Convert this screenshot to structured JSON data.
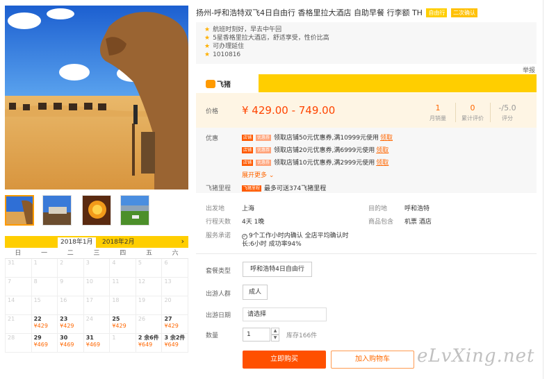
{
  "product": {
    "title": "扬州-呼和浩特双飞4日自由行 香格里拉大酒店 自助早餐 行李额 TH",
    "tags": [
      "自由行",
      "二次确认"
    ],
    "features": [
      "航班时刻好，早去中午回",
      "5星香格里拉大酒店，舒适享受，性价比高",
      "可办理延住",
      "1010816"
    ],
    "report_label": "举报"
  },
  "brand": {
    "name": "飞猪"
  },
  "price": {
    "label": "价格",
    "range": "¥ 429.00 - 749.00",
    "stats": [
      {
        "value": "1",
        "label": "月销量"
      },
      {
        "value": "0",
        "label": "累计评价"
      },
      {
        "value": "-/5.0",
        "label": "评分"
      }
    ]
  },
  "coupons": {
    "label": "优惠",
    "badge1": "店铺",
    "badge2": "优惠券",
    "items": [
      {
        "text": "领取店铺50元优惠券,满10999元使用",
        "action": "领取"
      },
      {
        "text": "领取店铺20元优惠券,满6999元使用",
        "action": "领取"
      },
      {
        "text": "领取店铺10元优惠券,满2999元使用",
        "action": "领取"
      }
    ],
    "more": "展开更多",
    "miles_label": "飞猪里程",
    "miles_badge": "飞猪里程",
    "miles_text": "最多可送374飞猪里程"
  },
  "details": {
    "depart_label": "出发地",
    "depart": "上海",
    "dest_label": "目的地",
    "dest": "呼和浩特",
    "days_label": "行程天数",
    "days": "4天 1晚",
    "includes_label": "商品包含",
    "includes": "机票  酒店",
    "promise_label": "服务承诺",
    "promise_line1": "9个工作小时内确认 全店平均确认时",
    "promise_line2": "长:6小时 成功率94%"
  },
  "options": {
    "package_label": "套餐类型",
    "package_value": "呼和浩特4日自由行",
    "crowd_label": "出游人群",
    "crowd_value": "成人",
    "date_label": "出游日期",
    "date_placeholder": "请选择",
    "qty_label": "数量",
    "qty_value": "1",
    "stock": "库存166件"
  },
  "actions": {
    "buy": "立即购买",
    "cart": "加入购物车"
  },
  "calendar": {
    "months": [
      "2018年1月",
      "2018年2月"
    ],
    "next": "›",
    "weekdays": [
      "日",
      "一",
      "二",
      "三",
      "四",
      "五",
      "六"
    ],
    "rows": [
      [
        {
          "d": "31"
        },
        {
          "d": "1"
        },
        {
          "d": "2"
        },
        {
          "d": "3"
        },
        {
          "d": "4"
        },
        {
          "d": "5"
        },
        {
          "d": "6"
        }
      ],
      [
        {
          "d": "7"
        },
        {
          "d": "8"
        },
        {
          "d": "9"
        },
        {
          "d": "10"
        },
        {
          "d": "11"
        },
        {
          "d": "12"
        },
        {
          "d": "13"
        }
      ],
      [
        {
          "d": "14"
        },
        {
          "d": "15"
        },
        {
          "d": "16"
        },
        {
          "d": "17"
        },
        {
          "d": "18"
        },
        {
          "d": "19"
        },
        {
          "d": "20"
        }
      ],
      [
        {
          "d": "21"
        },
        {
          "d": "22",
          "p": "¥429"
        },
        {
          "d": "23",
          "p": "¥429"
        },
        {
          "d": "24"
        },
        {
          "d": "25",
          "p": "¥429"
        },
        {
          "d": "26"
        },
        {
          "d": "27",
          "p": "¥429"
        }
      ],
      [
        {
          "d": "28"
        },
        {
          "d": "29",
          "p": "¥469"
        },
        {
          "d": "30",
          "p": "¥469"
        },
        {
          "d": "31",
          "p": "¥469"
        },
        {
          "d": "1"
        },
        {
          "d": "2 余6件",
          "p": "¥649"
        },
        {
          "d": "3 余2件",
          "p": "¥649"
        }
      ]
    ]
  },
  "watermark": "eLvXing.net",
  "colors": {
    "accent": "#ffce00",
    "price": "#ff4400",
    "buy": "#ff5000",
    "cream": "#fef5e4"
  }
}
